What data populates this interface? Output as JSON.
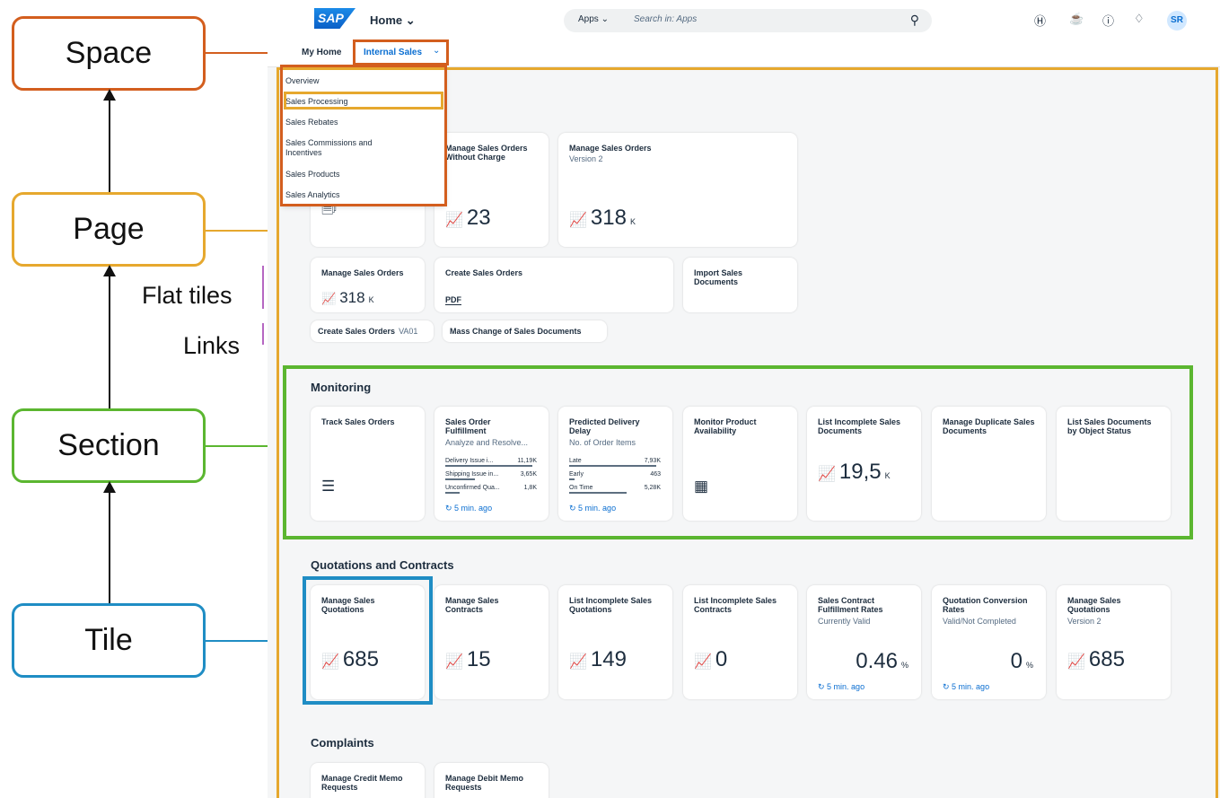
{
  "legend": {
    "space": "Space",
    "page": "Page",
    "section": "Section",
    "tile": "Tile",
    "flat_tiles": "Flat tiles",
    "links": "Links"
  },
  "colors": {
    "space": "#d35e1e",
    "page": "#e6a82e",
    "section": "#5bb630",
    "tile": "#1f8dc4",
    "accent": "#0a6ed1"
  },
  "shell": {
    "logo": "SAP",
    "title": "Home ⌄",
    "search_scope": "Apps ⌄",
    "search_placeholder": "Search in: Apps",
    "avatar": "SR"
  },
  "spaces": {
    "my_home": "My Home",
    "internal_sales": "Internal Sales",
    "chevron": "⌄"
  },
  "dropdown": [
    "Overview",
    "Sales Processing",
    "Sales Rebates",
    "Sales Commissions and Incentives",
    "Sales Products",
    "Sales Analytics"
  ],
  "processing": {
    "tiles": [
      {
        "title": "Manage Sales Orders Without Charge",
        "kpi": "23"
      },
      {
        "title": "Manage Sales Orders",
        "subtitle": "Version 2",
        "kpi": "318",
        "unit": "K"
      }
    ],
    "flat": [
      {
        "title": "Manage Sales Orders",
        "kpi": "318",
        "unit": "K"
      },
      {
        "title": "Create Sales Orders",
        "icon": "PDF"
      },
      {
        "title": "Import Sales Documents"
      }
    ],
    "links": [
      {
        "title": "Create Sales Orders",
        "sub": "VA01"
      },
      {
        "title": "Mass Change of Sales Documents"
      }
    ]
  },
  "monitoring": {
    "title": "Monitoring",
    "tiles": [
      {
        "title": "Track Sales Orders"
      },
      {
        "title": "Sales Order Fulfillment",
        "subtitle": "Analyze and Resolve...",
        "rows": [
          {
            "name": "Delivery Issue i...",
            "value": "11,19K",
            "share": 0.95
          },
          {
            "name": "Shipping Issue in...",
            "value": "3,65K",
            "share": 0.32
          },
          {
            "name": "Unconfirmed Qua...",
            "value": "1,8K",
            "share": 0.16
          }
        ],
        "refresh": "5 min. ago"
      },
      {
        "title": "Predicted Delivery Delay",
        "subtitle": "No. of Order Items",
        "rows": [
          {
            "name": "Late",
            "value": "7,93K",
            "share": 0.95
          },
          {
            "name": "Early",
            "value": "463",
            "share": 0.06
          },
          {
            "name": "On Time",
            "value": "5,28K",
            "share": 0.63
          }
        ],
        "refresh": "5 min. ago"
      },
      {
        "title": "Monitor Product Availability"
      },
      {
        "title": "List Incomplete Sales Documents",
        "kpi": "19,5",
        "unit": "K"
      },
      {
        "title": "Manage Duplicate Sales Documents"
      },
      {
        "title": "List Sales Documents by Object Status"
      }
    ]
  },
  "quotations": {
    "title": "Quotations and Contracts",
    "tiles": [
      {
        "title": "Manage Sales Quotations",
        "kpi": "685"
      },
      {
        "title": "Manage Sales Contracts",
        "kpi": "15"
      },
      {
        "title": "List Incomplete Sales Quotations",
        "kpi": "149"
      },
      {
        "title": "List Incomplete Sales Contracts",
        "kpi": "0"
      },
      {
        "title": "Sales Contract Fulfillment Rates",
        "subtitle": "Currently Valid",
        "kpi": "0.46",
        "unit": "%",
        "refresh": "5 min. ago"
      },
      {
        "title": "Quotation Conversion Rates",
        "subtitle": "Valid/Not Completed",
        "kpi": "0",
        "unit": "%",
        "refresh": "5 min. ago"
      },
      {
        "title": "Manage Sales Quotations",
        "subtitle": "Version 2",
        "kpi": "685"
      }
    ]
  },
  "complaints": {
    "title": "Complaints",
    "tiles": [
      {
        "title": "Manage Credit Memo Requests"
      },
      {
        "title": "Manage Debit Memo Requests"
      }
    ]
  }
}
